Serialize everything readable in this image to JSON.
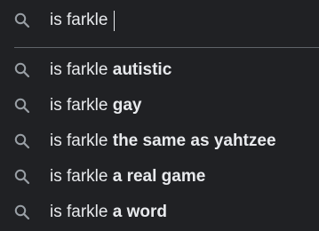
{
  "search": {
    "value": "is farkle ",
    "icon": "search-icon"
  },
  "suggestions": [
    {
      "prefix": "is farkle",
      "completion": "autistic",
      "icon": "search-icon"
    },
    {
      "prefix": "is farkle",
      "completion": "gay",
      "icon": "search-icon"
    },
    {
      "prefix": "is farkle",
      "completion": "the same as yahtzee",
      "icon": "search-icon"
    },
    {
      "prefix": "is farkle",
      "completion": "a real game",
      "icon": "search-icon"
    },
    {
      "prefix": "is farkle",
      "completion": "a word",
      "icon": "search-icon"
    }
  ],
  "colors": {
    "background": "#202124",
    "text": "#e8eaed",
    "icon": "#9aa0a6",
    "divider": "#5f6368"
  }
}
